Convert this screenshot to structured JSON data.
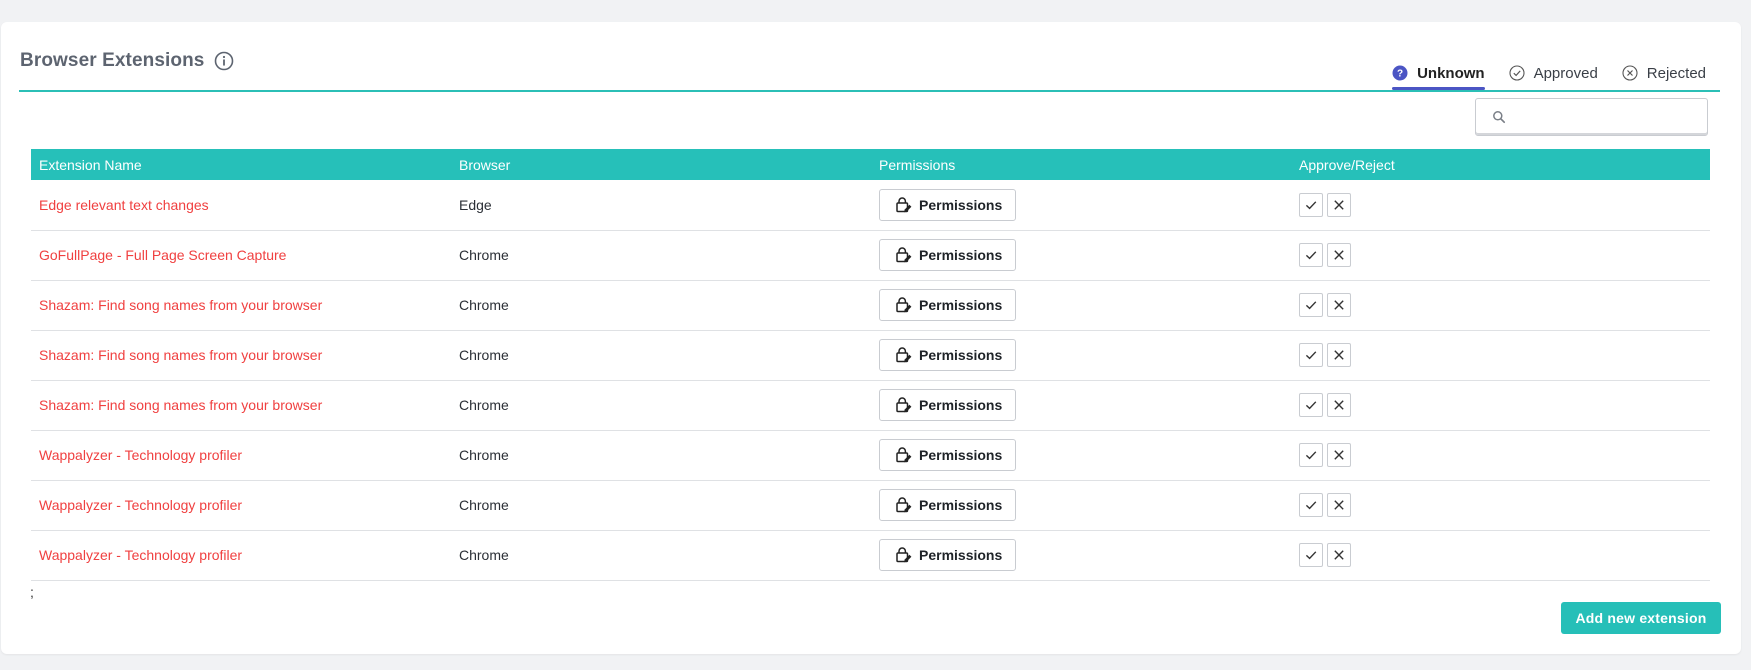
{
  "header": {
    "title": "Browser Extensions",
    "info_icon": "info-circle-icon"
  },
  "tabs": [
    {
      "label": "Unknown",
      "icon": "question-circle-icon",
      "active": true,
      "icon_color": "#4b55c4"
    },
    {
      "label": "Approved",
      "icon": "check-circle-icon",
      "active": false
    },
    {
      "label": "Rejected",
      "icon": "x-circle-icon",
      "active": false
    }
  ],
  "search": {
    "placeholder": "",
    "value": "",
    "icon": "search-icon"
  },
  "table": {
    "columns": [
      "Extension Name",
      "Browser",
      "Permissions",
      "Approve/Reject"
    ],
    "rows": [
      {
        "name": "Edge relevant text changes",
        "browser": "Edge",
        "permissions_label": "Permissions"
      },
      {
        "name": "GoFullPage - Full Page Screen Capture",
        "browser": "Chrome",
        "permissions_label": "Permissions"
      },
      {
        "name": "Shazam: Find song names from your browser",
        "browser": "Chrome",
        "permissions_label": "Permissions"
      },
      {
        "name": "Shazam: Find song names from your browser",
        "browser": "Chrome",
        "permissions_label": "Permissions"
      },
      {
        "name": "Shazam: Find song names from your browser",
        "browser": "Chrome",
        "permissions_label": "Permissions"
      },
      {
        "name": "Wappalyzer - Technology profiler",
        "browser": "Chrome",
        "permissions_label": "Permissions"
      },
      {
        "name": "Wappalyzer - Technology profiler",
        "browser": "Chrome",
        "permissions_label": "Permissions"
      },
      {
        "name": "Wappalyzer - Technology profiler",
        "browser": "Chrome",
        "permissions_label": "Permissions"
      }
    ]
  },
  "footer": {
    "mark": ";",
    "add_button_label": "Add new extension"
  },
  "colors": {
    "accent": "#26c0b9",
    "extension_name": "#f04040",
    "active_tab": "#4b55c4"
  }
}
